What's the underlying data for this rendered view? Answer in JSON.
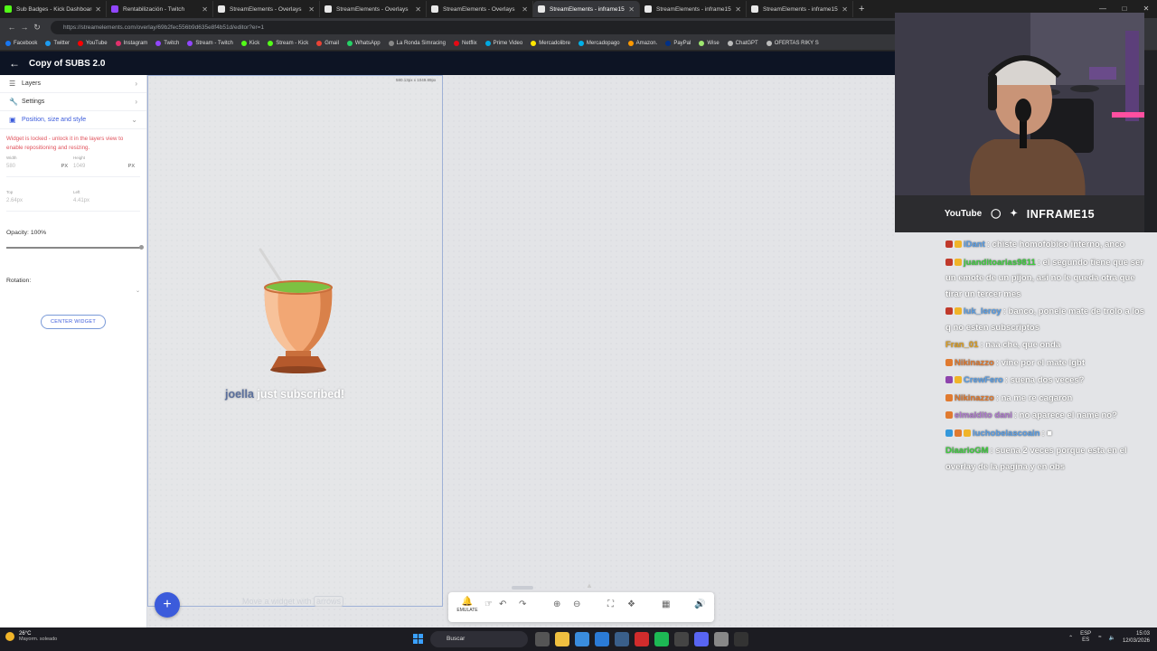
{
  "browser": {
    "tabs": [
      {
        "label": "Sub Badges - Kick Dashboard",
        "color": "#53fc18",
        "active": false
      },
      {
        "label": "Rentabilización - Twitch",
        "color": "#9146ff",
        "active": false
      },
      {
        "label": "StreamElements - Overlays",
        "color": "#e8e8e8",
        "active": false
      },
      {
        "label": "StreamElements - Overlays",
        "color": "#e8e8e8",
        "active": false
      },
      {
        "label": "StreamElements - Overlays",
        "color": "#e8e8e8",
        "active": false
      },
      {
        "label": "StreamElements - inframe15",
        "color": "#e8e8e8",
        "active": true
      },
      {
        "label": "StreamElements - inframe15",
        "color": "#e8e8e8",
        "active": false
      },
      {
        "label": "StreamElements - inframe15",
        "color": "#e8e8e8",
        "active": false
      }
    ],
    "url": "https://streamelements.com/overlay/69b2fec556b9d635e8f4b51d/editor?er=1",
    "bookmarks": [
      {
        "label": "Facebook",
        "color": "#1877f2"
      },
      {
        "label": "Twitter",
        "color": "#1d9bf0"
      },
      {
        "label": "YouTube",
        "color": "#ff0000"
      },
      {
        "label": "Instagram",
        "color": "#e1306c"
      },
      {
        "label": "Twitch",
        "color": "#9146ff"
      },
      {
        "label": "Stream - Twitch",
        "color": "#9146ff"
      },
      {
        "label": "Kick",
        "color": "#53fc18"
      },
      {
        "label": "Stream - Kick",
        "color": "#53fc18"
      },
      {
        "label": "Gmail",
        "color": "#ea4335"
      },
      {
        "label": "WhatsApp",
        "color": "#25d366"
      },
      {
        "label": "La Ronda Simracing",
        "color": "#888888"
      },
      {
        "label": "Netflix",
        "color": "#e50914"
      },
      {
        "label": "Prime Video",
        "color": "#00a8e1"
      },
      {
        "label": "Mercadolibre",
        "color": "#ffe600"
      },
      {
        "label": "Mercadopago",
        "color": "#00b1ea"
      },
      {
        "label": "Amazon.",
        "color": "#ff9900"
      },
      {
        "label": "PayPal",
        "color": "#003087"
      },
      {
        "label": "Wise",
        "color": "#9fe870"
      },
      {
        "label": "ChatGPT",
        "color": "#bbbbbb"
      },
      {
        "label": "OFERTAS RIKY S",
        "color": "#bbbbbb"
      }
    ]
  },
  "editor": {
    "title": "Copy of SUBS 2.0",
    "panel": {
      "layers": "Layers",
      "settings": "Settings",
      "position": "Position, size and style",
      "lock_message": "Widget is locked - unlock it in the layers view to enable repositioning and resizing.",
      "width_label": "Width",
      "width_value": "580",
      "height_label": "Height",
      "height_value": "1049",
      "unit": "PX",
      "top_label": "Top",
      "top_value": "2.64px",
      "left_label": "Left",
      "left_value": "4.41px",
      "opacity_label": "Opacity: 100%",
      "opacity": 1.0,
      "rotation_label": "Rotation:",
      "center_button": "CENTER WIDGET"
    },
    "canvas": {
      "size_label": "580.13px x 1049.89px",
      "sub_name": "joella",
      "sub_text": " just subscribed!",
      "hint_prefix": "Move a widget with ",
      "hint_key": "arrows",
      "add_button": "+"
    },
    "toolbar": {
      "emulate": "EMULATE"
    }
  },
  "stream": {
    "brand_youtube": "YouTube",
    "brand_name": "INFRAME15",
    "chat": [
      {
        "user": "iDant",
        "user_color": "#5aa0e8",
        "badges": [
          "#c0392b",
          "#f0b429"
        ],
        "text": ": chiste homofobico interno, anco"
      },
      {
        "user": "juanditoarias9811",
        "user_color": "#3ecf3e",
        "badges": [
          "#c0392b",
          "#f0b429"
        ],
        "text": ": el segundo tiene que ser un emote de un pijon, asi no le queda otra que tirar un tercer mes"
      },
      {
        "user": "luk_leroy",
        "user_color": "#5aa0e8",
        "badges": [
          "#c0392b",
          "#f0b429"
        ],
        "text": ": banco, ponele mate de trolo a los q no esten subscriptos"
      },
      {
        "user": "Fran_01",
        "user_color": "#e0a020",
        "badges": [],
        "text": ": naa che, que onda"
      },
      {
        "user": "Nikinazzo",
        "user_color": "#e07a30",
        "badges": [
          "#e07a30"
        ],
        "text": ": vine por el mate lgbt"
      },
      {
        "user": "CrewFero",
        "user_color": "#5aa0e8",
        "badges": [
          "#8e44ad",
          "#f0b429"
        ],
        "text": ": suena dos veces?"
      },
      {
        "user": "Nikinazzo",
        "user_color": "#e07a30",
        "badges": [
          "#e07a30"
        ],
        "text": ": na me re cagaron"
      },
      {
        "user": "elmaldito dani",
        "user_color": "#b07ad0",
        "badges": [
          "#e07a30"
        ],
        "text": ": no aparece el name no?"
      },
      {
        "user": "luchobelascoain",
        "user_color": "#5aa0e8",
        "badges": [
          "#3498db",
          "#e07a30",
          "#f0b429"
        ],
        "text": ": ■"
      },
      {
        "user": "DiaarioGM",
        "user_color": "#3ecf3e",
        "badges": [],
        "text": ": suena 2 veces porque esta en el overlay de la pagina y en obs"
      }
    ]
  },
  "taskbar": {
    "temp": "26°C",
    "weather": "Mayorm. soleado",
    "search": "Buscar",
    "lang1": "ESP",
    "lang2": "ES",
    "time": "15:03",
    "date": "12/03/2026"
  }
}
